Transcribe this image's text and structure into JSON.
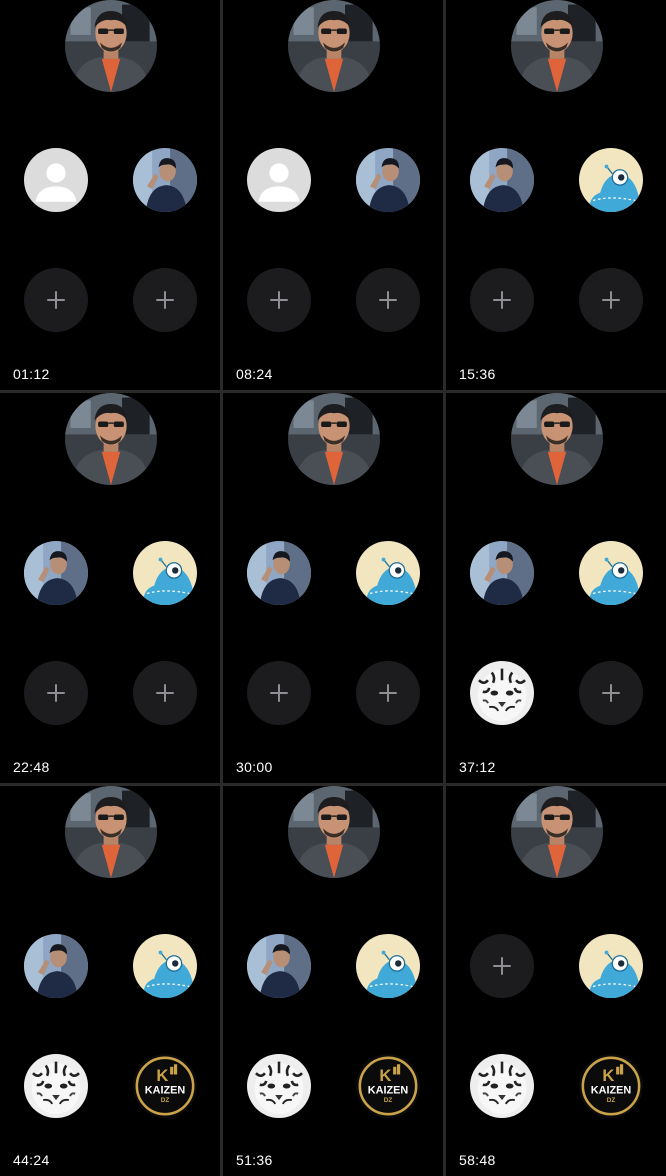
{
  "colors": {
    "background": "#000000",
    "divider": "#2a2a2a",
    "add_button": "#1c1c1e",
    "plus": "#8e8e93",
    "text": "#ffffff"
  },
  "icons": {
    "host": "host-photo-avatar",
    "default": "default-profile-icon",
    "person": "person-photo-avatar",
    "alien": "blue-alien-avatar",
    "tiger": "white-tiger-avatar",
    "kaizen": "kaizen-logo-avatar",
    "add": "plus-icon"
  },
  "panels": [
    {
      "time": "01:12",
      "slots": [
        "default",
        "person",
        "add",
        "add"
      ]
    },
    {
      "time": "08:24",
      "slots": [
        "default",
        "person",
        "add",
        "add"
      ]
    },
    {
      "time": "15:36",
      "slots": [
        "person",
        "alien",
        "add",
        "add"
      ]
    },
    {
      "time": "22:48",
      "slots": [
        "person",
        "alien",
        "add",
        "add"
      ]
    },
    {
      "time": "30:00",
      "slots": [
        "person",
        "alien",
        "add",
        "add"
      ]
    },
    {
      "time": "37:12",
      "slots": [
        "person",
        "alien",
        "tiger",
        "add"
      ]
    },
    {
      "time": "44:24",
      "slots": [
        "person",
        "alien",
        "tiger",
        "kaizen"
      ]
    },
    {
      "time": "51:36",
      "slots": [
        "person",
        "alien",
        "tiger",
        "kaizen"
      ]
    },
    {
      "time": "58:48",
      "slots": [
        "add",
        "alien",
        "tiger",
        "kaizen"
      ]
    }
  ],
  "kaizen_logo": {
    "mark": "K",
    "name": "KAIZEN",
    "suffix": "DZ"
  }
}
